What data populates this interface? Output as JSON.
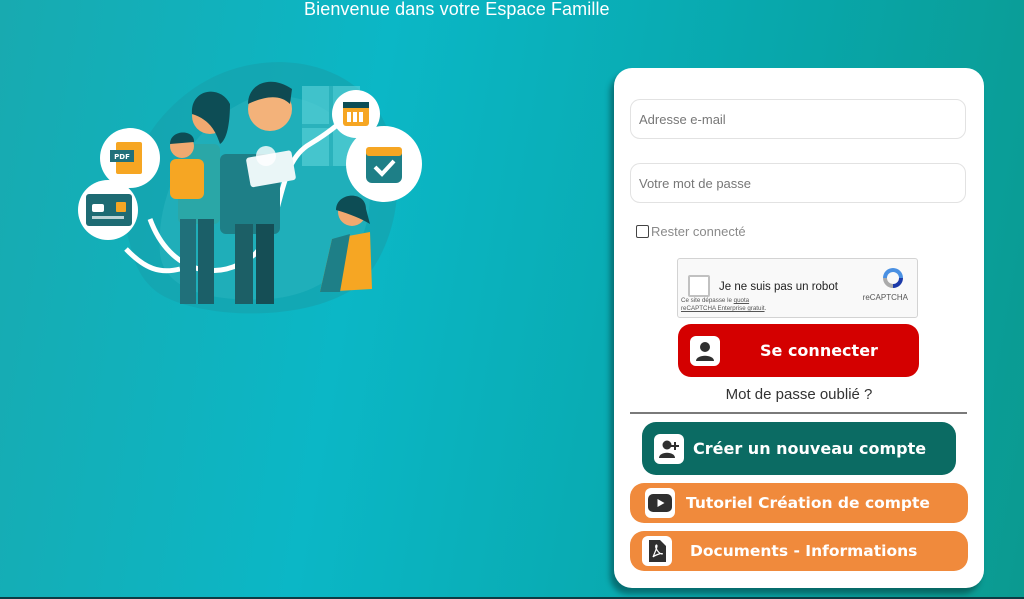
{
  "header": {
    "welcome": "Bienvenue dans votre Espace Famille"
  },
  "illustration": {
    "pdf_label": "PDF"
  },
  "login": {
    "email_placeholder": "Adresse e-mail",
    "password_placeholder": "Votre mot de passe",
    "remember_label": "Rester connecté",
    "captcha": {
      "label": "Je ne suis pas un robot",
      "notice_prefix": "Ce site dépasse le ",
      "notice_link_1": "quota",
      "notice_link_2": "reCAPTCHA Enterprise gratuit",
      "notice_suffix": ".",
      "brand": "reCAPTCHA"
    },
    "submit_label": "Se connecter",
    "forgot_label": "Mot de passe oublié ?"
  },
  "actions": {
    "create_label": "Créer un nouveau compte",
    "tutorial_label": "Tutoriel Création de compte",
    "documents_label": "Documents - Informations"
  },
  "colors": {
    "background": "#0bb7c6",
    "login_button": "#d40000",
    "create_button": "#0b6b63",
    "secondary_buttons": "#f08a3c"
  }
}
